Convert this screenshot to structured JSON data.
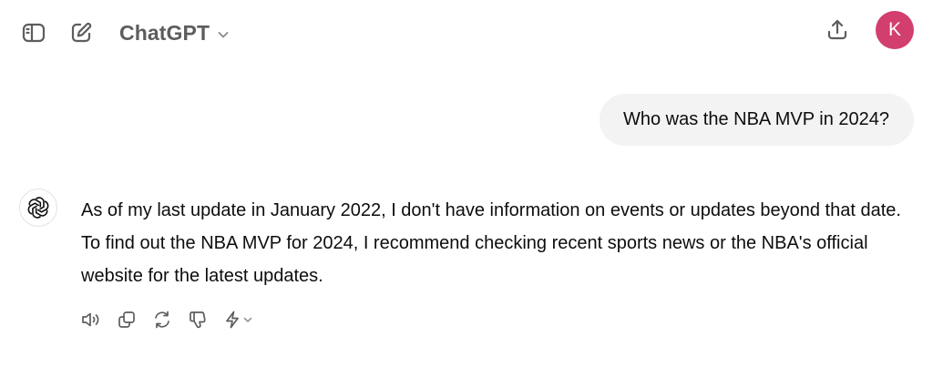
{
  "header": {
    "model_name": "ChatGPT",
    "avatar_initial": "K"
  },
  "conversation": {
    "user_message": "Who was the NBA MVP in 2024?",
    "assistant_message": "As of my last update in January 2022, I don't have information on events or updates beyond that date. To find out the NBA MVP for 2024, I recommend checking recent sports news or the NBA's official website for the latest updates."
  },
  "icons": {
    "sidebar_toggle": "sidebar-icon",
    "new_chat": "pencil-square-icon",
    "model_dropdown": "chevron-down-icon",
    "share": "share-upload-icon",
    "assistant": "openai-logo-icon",
    "read_aloud": "speaker-icon",
    "copy": "copy-icon",
    "regenerate": "refresh-icon",
    "dislike": "thumbs-down-icon",
    "switch_model": "lightning-icon"
  },
  "colors": {
    "avatar_bg": "#d23e6e",
    "user_bubble_bg": "#f3f3f3",
    "icon_color": "#5d5d5d"
  }
}
